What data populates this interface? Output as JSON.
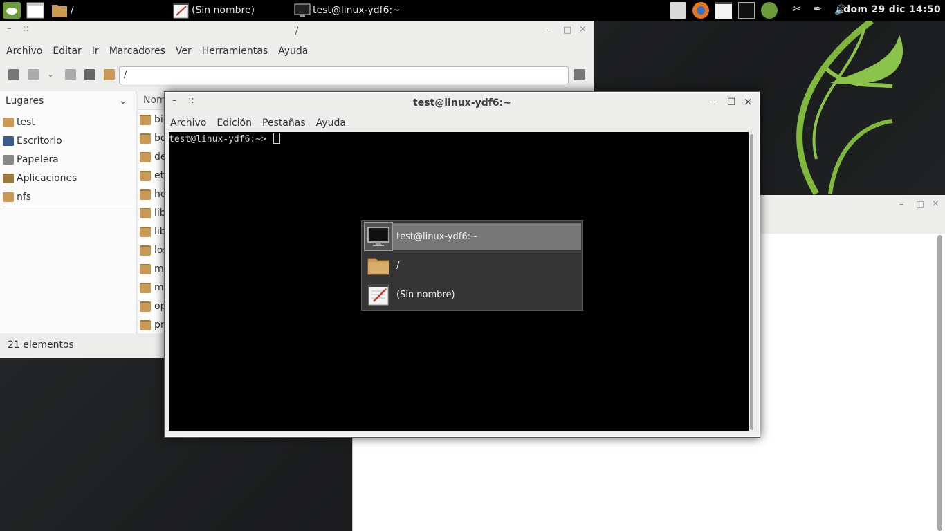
{
  "panel": {
    "tasks": [
      {
        "label": "/"
      },
      {
        "label": "(Sin nombre)"
      },
      {
        "label": "test@linux-ydf6:~"
      }
    ],
    "clock": "dom 29 dic 14:50"
  },
  "file_manager": {
    "title": "/",
    "menu": [
      "Archivo",
      "Editar",
      "Ir",
      "Marcadores",
      "Ver",
      "Herramientas",
      "Ayuda"
    ],
    "location": "/",
    "sidebar": {
      "header": "Lugares",
      "items": [
        "test",
        "Escritorio",
        "Papelera",
        "Aplicaciones",
        "nfs"
      ]
    },
    "column_header": "Nom",
    "files": [
      "bin",
      "bo",
      "de",
      "et",
      "ho",
      "lib",
      "lib",
      "los",
      "me",
      "mr",
      "op",
      "pro"
    ],
    "status": "21 elementos"
  },
  "terminal": {
    "title": "test@linux-ydf6:~",
    "menu": [
      "Archivo",
      "Edición",
      "Pestañas",
      "Ayuda"
    ],
    "prompt": "test@linux-ydf6:~> "
  },
  "switcher": {
    "items": [
      {
        "label": "test@linux-ydf6:~",
        "icon": "monitor-icon",
        "selected": true
      },
      {
        "label": "/",
        "icon": "folder-icon",
        "selected": false
      },
      {
        "label": "(Sin nombre)",
        "icon": "text-editor-icon",
        "selected": false
      }
    ]
  },
  "colors": {
    "panel": "#000000",
    "wallpaper_accent": "#8bc34a",
    "terminal_bg": "#000000",
    "switcher_bg": "#353535",
    "switcher_selected": "#777777"
  }
}
